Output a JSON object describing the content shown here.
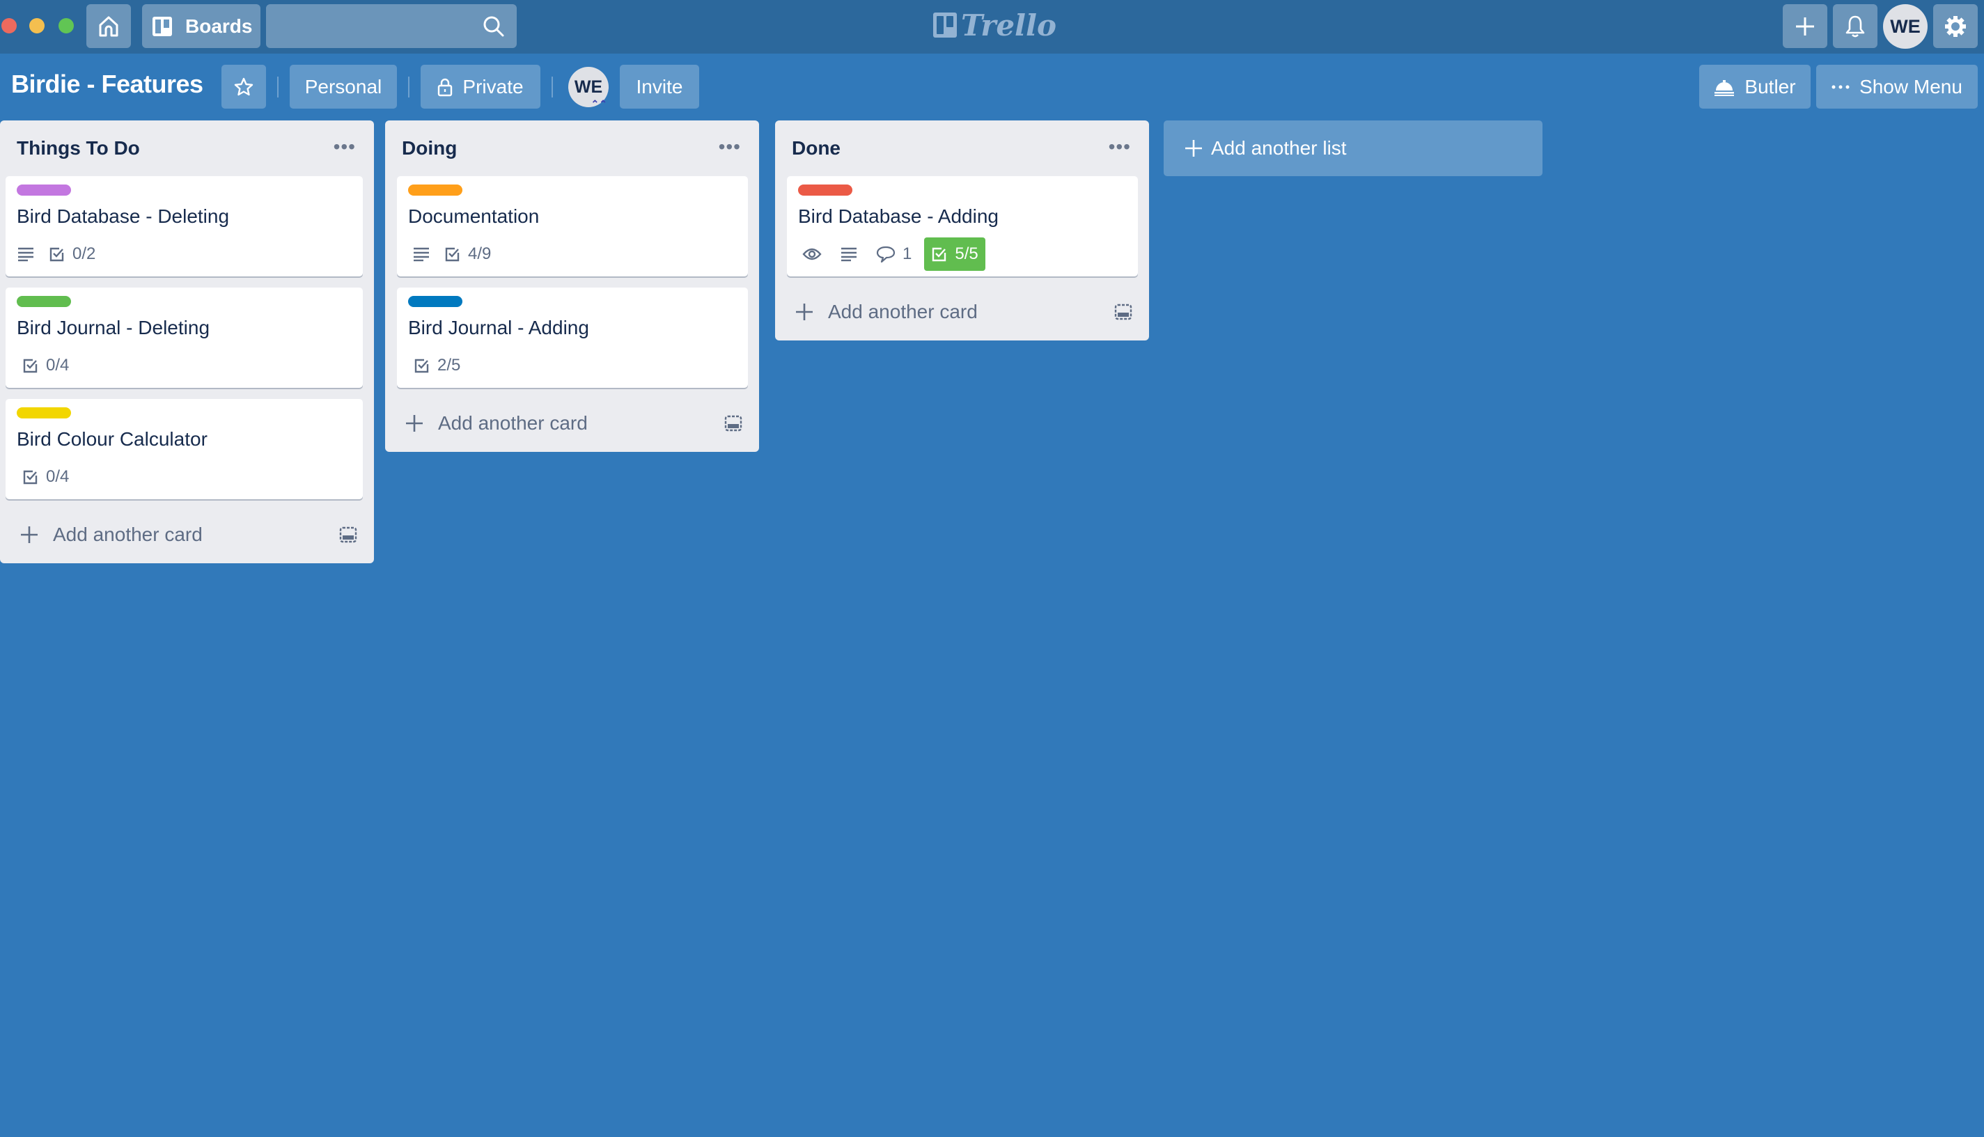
{
  "topbar": {
    "home_icon": "home-icon",
    "boards_label": "Boards",
    "search_placeholder": "",
    "logo_text": "Trello",
    "avatar_initials": "WE"
  },
  "board": {
    "title": "Birdie - Features",
    "team_label": "Personal",
    "visibility_label": "Private",
    "member_initials": "WE",
    "invite_label": "Invite",
    "butler_label": "Butler",
    "show_menu_label": "Show Menu"
  },
  "lists": [
    {
      "title": "Things To Do",
      "add_card_label": "Add another card",
      "cards": [
        {
          "title": "Bird Database - Deleting",
          "label_color": "#c377e0",
          "has_description": true,
          "checklist": "0/2"
        },
        {
          "title": "Bird Journal - Deleting",
          "label_color": "#61bd4f",
          "has_description": false,
          "checklist": "0/4"
        },
        {
          "title": "Bird Colour Calculator",
          "label_color": "#f2d600",
          "has_description": false,
          "checklist": "0/4"
        }
      ]
    },
    {
      "title": "Doing",
      "add_card_label": "Add another card",
      "cards": [
        {
          "title": "Documentation",
          "label_color": "#ff9f1a",
          "has_description": true,
          "checklist": "4/9"
        },
        {
          "title": "Bird Journal - Adding",
          "label_color": "#0079bf",
          "has_description": false,
          "checklist": "2/5"
        }
      ]
    },
    {
      "title": "Done",
      "add_card_label": "Add another card",
      "cards": [
        {
          "title": "Bird Database - Adding",
          "label_color": "#eb5a46",
          "watching": true,
          "has_description": true,
          "comments": "1",
          "checklist": "5/5",
          "checklist_complete": true
        }
      ]
    }
  ],
  "add_list_label": "Add another list",
  "colors": {
    "board_bg": "#3179ba",
    "topbar_bg": "#2c689c",
    "list_bg": "#ebecf0",
    "checklist_done": "#61bd4f"
  }
}
